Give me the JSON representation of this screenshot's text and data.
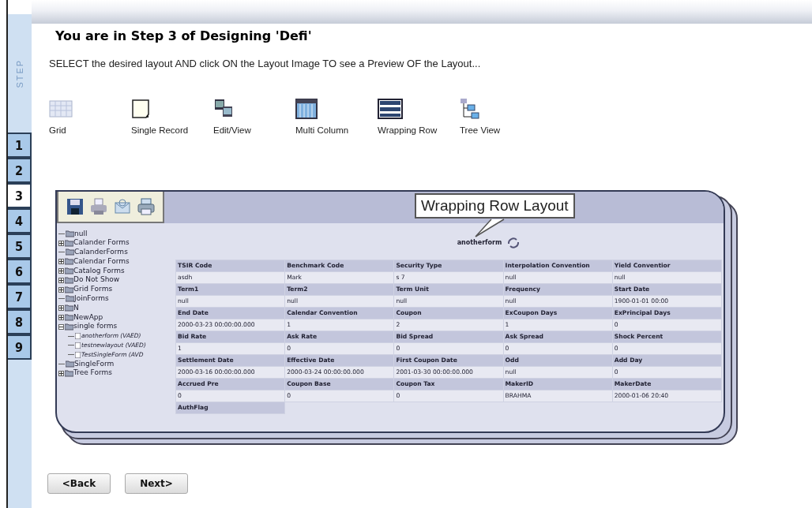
{
  "step_bar": {
    "label": "STEP",
    "steps": [
      {
        "label": "1",
        "selected": false
      },
      {
        "label": "2",
        "selected": false
      },
      {
        "label": "3",
        "selected": true
      },
      {
        "label": "4",
        "selected": false
      },
      {
        "label": "5",
        "selected": false
      },
      {
        "label": "6",
        "selected": false
      },
      {
        "label": "7",
        "selected": false
      },
      {
        "label": "8",
        "selected": false
      },
      {
        "label": "9",
        "selected": false
      }
    ]
  },
  "title": "You are in Step 3 of Designing 'Defi'",
  "instruction": "SELECT the desired layout AND click ON the Layout Image TO see a Preview OF the Layout...",
  "layouts": [
    {
      "label": "Grid",
      "kind": "grid"
    },
    {
      "label": "Single Record",
      "kind": "single"
    },
    {
      "label": "Edit/View",
      "kind": "editview"
    },
    {
      "label": "Multi Column",
      "kind": "multicolumn"
    },
    {
      "label": "Wrapping Row",
      "kind": "wrapping"
    },
    {
      "label": "Tree View",
      "kind": "tree"
    }
  ],
  "preview": {
    "callout": "Wrapping Row Layout",
    "form_title": "anotherform",
    "tree": [
      {
        "label": "null",
        "kind": "leaf"
      },
      {
        "label": "Calander Forms",
        "kind": "group",
        "expanded": false
      },
      {
        "label": "CalanderForms",
        "kind": "leaf"
      },
      {
        "label": "Calendar Forms",
        "kind": "group",
        "expanded": false
      },
      {
        "label": "Catalog Forms",
        "kind": "group",
        "expanded": false
      },
      {
        "label": "Do Not Show",
        "kind": "group",
        "expanded": false
      },
      {
        "label": "Grid Forms",
        "kind": "group",
        "expanded": false
      },
      {
        "label": "JoinForms",
        "kind": "leaf"
      },
      {
        "label": "N",
        "kind": "group",
        "expanded": false
      },
      {
        "label": "NewApp",
        "kind": "group",
        "expanded": false
      },
      {
        "label": "single forms",
        "kind": "group",
        "expanded": true,
        "children": [
          {
            "label": "anotherform (VAED)",
            "kind": "form"
          },
          {
            "label": "testnewlayout (VAED)",
            "kind": "form"
          },
          {
            "label": "TestSingleForm (AVD",
            "kind": "form"
          }
        ]
      },
      {
        "label": "SingleForm",
        "kind": "leaf"
      },
      {
        "label": "Tree Forms",
        "kind": "group",
        "expanded": false
      }
    ],
    "table_rows": [
      {
        "headers": [
          "TSIR Code",
          "Benchmark Code",
          "Security Type",
          "Interpolation Convention",
          "Yield Conventior"
        ],
        "values": [
          "asdh",
          "Mark",
          "s 7",
          "null",
          "null"
        ]
      },
      {
        "headers": [
          "Term1",
          "Term2",
          "Term Unit",
          "Frequency",
          "Start Date"
        ],
        "values": [
          "null",
          "null",
          "null",
          "null",
          "1900-01-01 00:00"
        ]
      },
      {
        "headers": [
          "End Date",
          "Calendar Convention",
          "Coupon",
          "ExCoupon Days",
          "ExPrincipal Days"
        ],
        "values": [
          "2000-03-23 00:00:00.000",
          "1",
          "2",
          "1",
          "0"
        ]
      },
      {
        "headers": [
          "Bid Rate",
          "Ask Rate",
          "Bid Spread",
          "Ask Spread",
          "Shock Percent"
        ],
        "values": [
          "1",
          "0",
          "0",
          "0",
          "0"
        ]
      },
      {
        "headers": [
          "Settlement Date",
          "Effective Date",
          "First Coupon Date",
          "Odd",
          "Add Day"
        ],
        "values": [
          "2000-03-16 00:00:00.000",
          "2000-03-24 00:00:00.000",
          "2001-03-30 00:00:00.000",
          "null",
          "0"
        ]
      },
      {
        "headers": [
          "Accrued Pre",
          "Coupon Base",
          "Coupon Tax",
          "MakerID",
          "MakerDate"
        ],
        "values": [
          "0",
          "0",
          "0",
          "BRAHMA",
          "2000-01-06 20:40"
        ]
      },
      {
        "headers": [
          "AuthFlag"
        ]
      }
    ]
  },
  "buttons": [
    "<Back",
    "Next>"
  ]
}
